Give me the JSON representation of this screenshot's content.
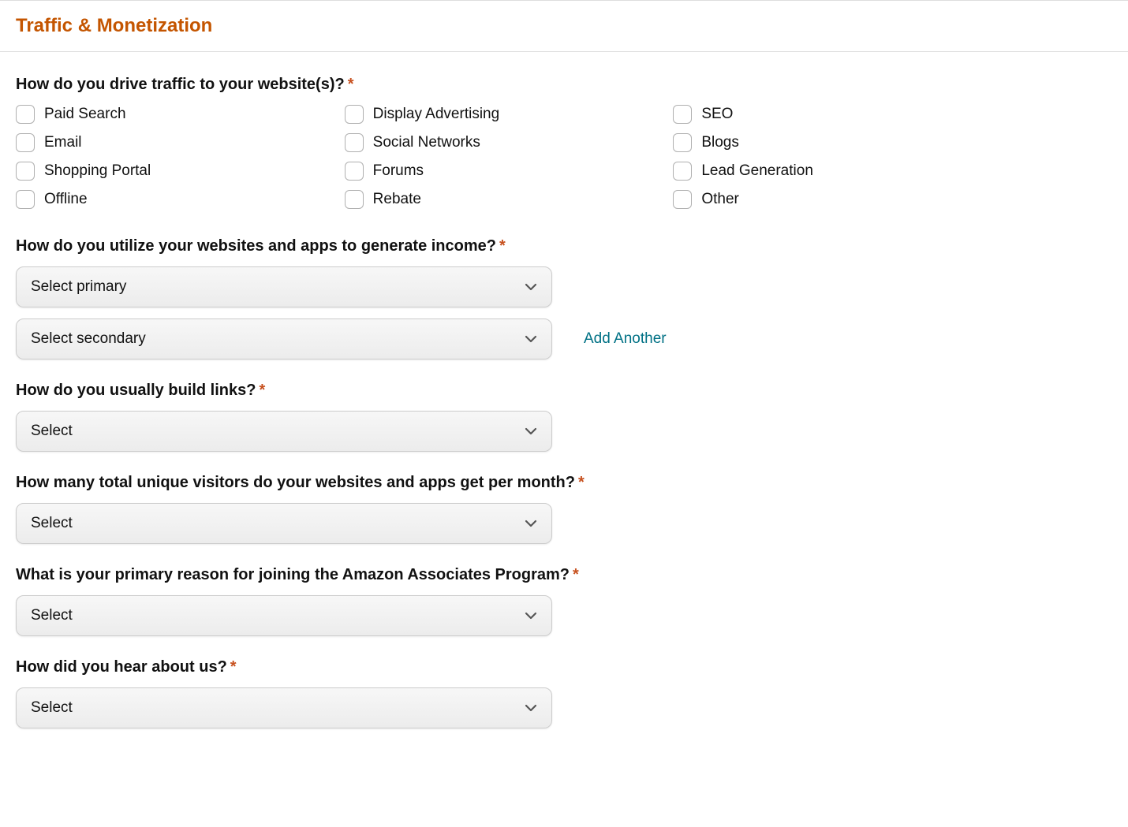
{
  "section": {
    "title": "Traffic & Monetization"
  },
  "traffic": {
    "question": "How do you drive traffic to your website(s)?",
    "options": {
      "r1c1": "Paid Search",
      "r1c2": "Display Advertising",
      "r1c3": "SEO",
      "r2c1": "Email",
      "r2c2": "Social Networks",
      "r2c3": "Blogs",
      "r3c1": "Shopping Portal",
      "r3c2": "Forums",
      "r3c3": "Lead Generation",
      "r4c1": "Offline",
      "r4c2": "Rebate",
      "r4c3": "Other"
    }
  },
  "income": {
    "question": "How do you utilize your websites and apps to generate income?",
    "primary_placeholder": "Select primary",
    "secondary_placeholder": "Select secondary",
    "add_another": "Add Another"
  },
  "build_links": {
    "question": "How do you usually build links?",
    "placeholder": "Select"
  },
  "visitors": {
    "question": "How many total unique visitors do your websites and apps get per month?",
    "placeholder": "Select"
  },
  "reason": {
    "question": "What is your primary reason for joining the Amazon Associates Program?",
    "placeholder": "Select"
  },
  "hear": {
    "question": "How did you hear about us?",
    "placeholder": "Select"
  }
}
